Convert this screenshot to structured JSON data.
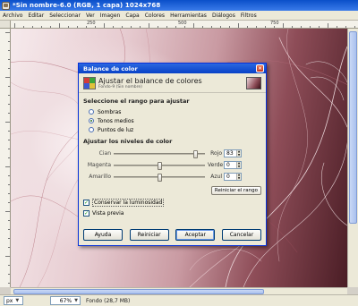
{
  "window": {
    "title": "*Sin nombre-6.0 (RGB, 1 capa) 1024x768"
  },
  "menubar": {
    "items": [
      "Archivo",
      "Editar",
      "Seleccionar",
      "Ver",
      "Imagen",
      "Capa",
      "Colores",
      "Herramientas",
      "Diálogos",
      "Filtros"
    ]
  },
  "ruler": {
    "labels": [
      "250",
      "500",
      "750"
    ]
  },
  "dialog": {
    "title": "Balance de color",
    "header_title": "Ajustar el balance de colores",
    "header_subtitle": "Fondo-9 (Sin nombre)",
    "range_section": "Seleccione el rango para ajustar",
    "ranges": [
      {
        "label": "Sombras",
        "checked": false
      },
      {
        "label": "Tonos medios",
        "checked": true
      },
      {
        "label": "Puntos de luz",
        "checked": false
      }
    ],
    "levels_section": "Ajustar los niveles de color",
    "sliders": [
      {
        "left": "Cian",
        "right": "Rojo",
        "value": "83",
        "fraction": 0.915
      },
      {
        "left": "Magenta",
        "right": "Verde",
        "value": "0",
        "fraction": 0.5
      },
      {
        "left": "Amarillo",
        "right": "Azul",
        "value": "0",
        "fraction": 0.5
      }
    ],
    "reset_range_label": "Reiniciar el rango",
    "preserve_luminosity": {
      "label": "Conservar la luminosidad",
      "checked": true
    },
    "preview": {
      "label": "Vista previa",
      "checked": true
    },
    "buttons": {
      "help": "Ayuda",
      "reset": "Reiniciar",
      "ok": "Aceptar",
      "cancel": "Cancelar"
    }
  },
  "statusbar": {
    "unit": "px",
    "zoom": "67%",
    "info": "Fondo (28,7 MB)"
  }
}
